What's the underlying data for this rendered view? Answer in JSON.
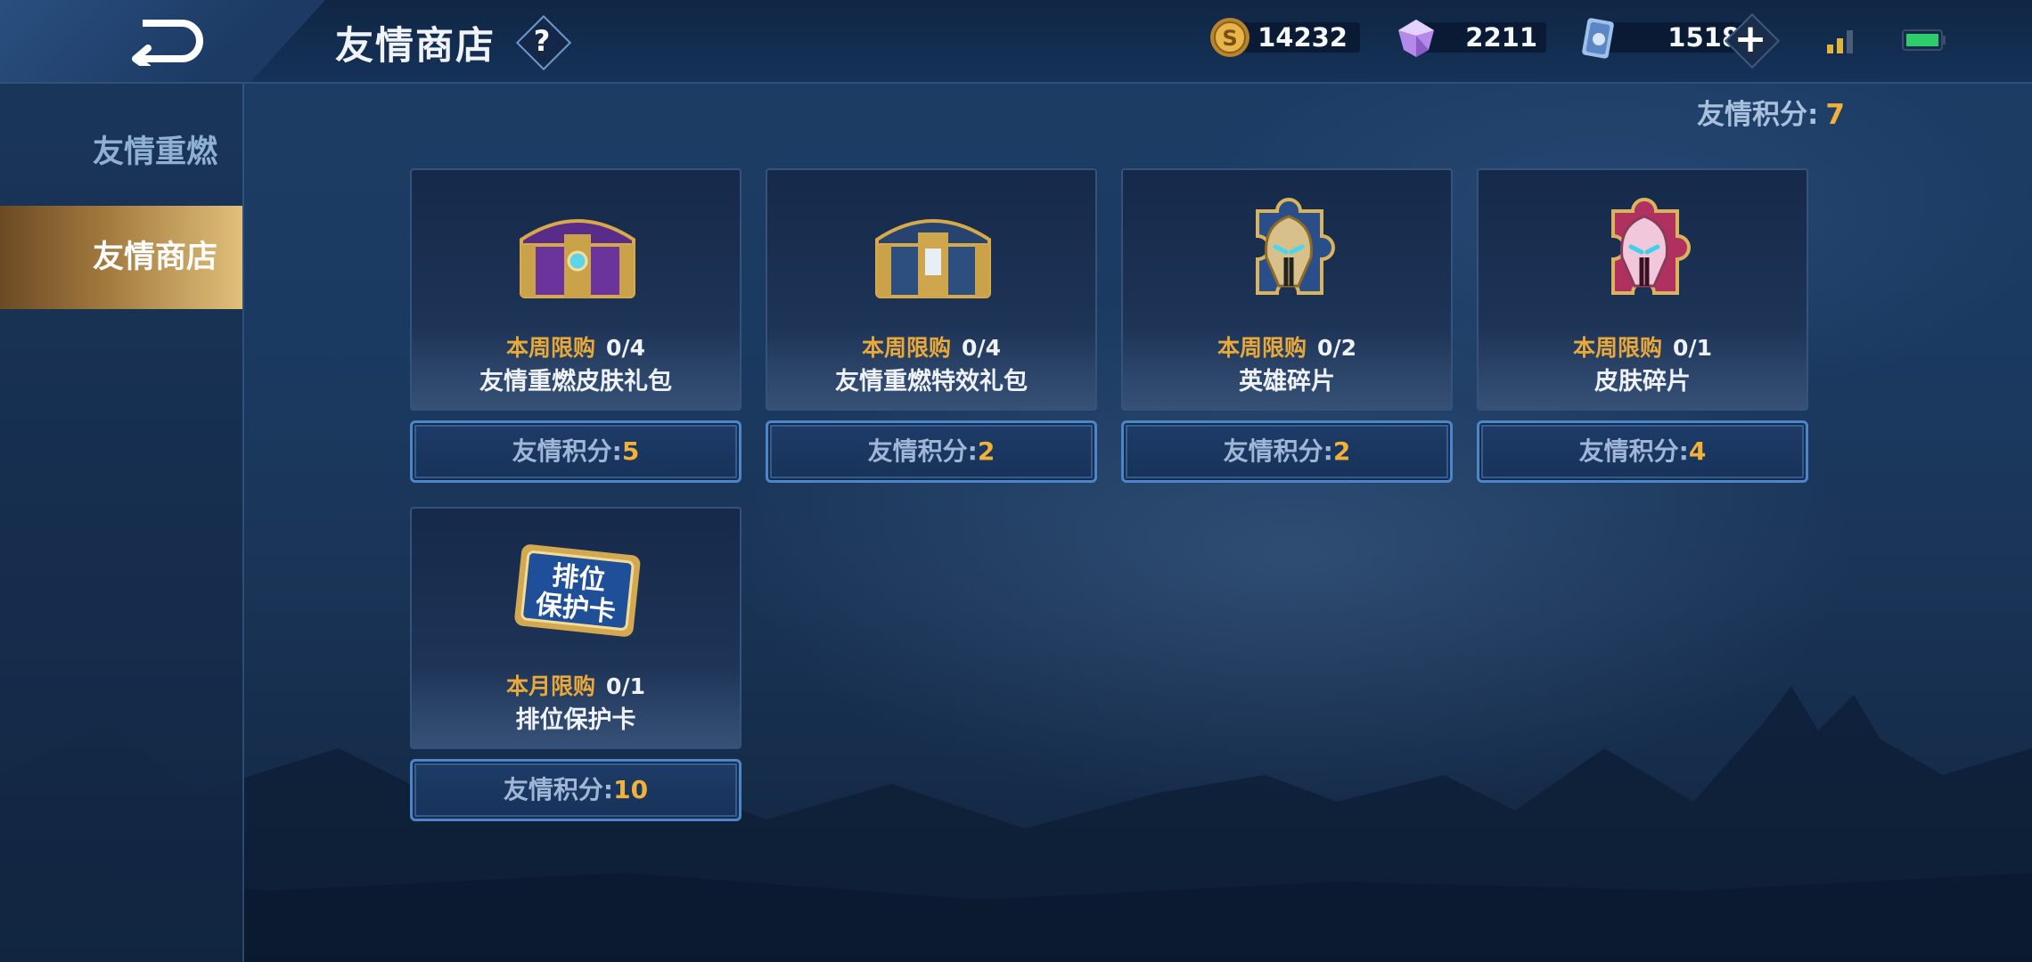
{
  "header": {
    "title": "友情商店",
    "help_label": "?",
    "currencies": [
      {
        "name": "gold-coin",
        "value": "14232"
      },
      {
        "name": "diamond",
        "value": "2211"
      },
      {
        "name": "coupon",
        "value": "1518"
      }
    ],
    "plus_label": "+"
  },
  "sidebar": {
    "items": [
      {
        "label": "友情重燃",
        "active": false
      },
      {
        "label": "友情商店",
        "active": true
      }
    ]
  },
  "score": {
    "label": "友情积分:",
    "value": "7"
  },
  "price_label": "友情积分:",
  "items": [
    {
      "limit_type": "本周限购",
      "limit_count": "0/4",
      "name": "友情重燃皮肤礼包",
      "price": "5",
      "icon": "purple-chest-icon"
    },
    {
      "limit_type": "本周限购",
      "limit_count": "0/4",
      "name": "友情重燃特效礼包",
      "price": "2",
      "icon": "blue-chest-icon"
    },
    {
      "limit_type": "本周限购",
      "limit_count": "0/2",
      "name": "英雄碎片",
      "price": "2",
      "icon": "hero-fragment-icon"
    },
    {
      "limit_type": "本周限购",
      "limit_count": "0/1",
      "name": "皮肤碎片",
      "price": "4",
      "icon": "skin-fragment-icon"
    },
    {
      "limit_type": "本月限购",
      "limit_count": "0/1",
      "name": "排位保护卡",
      "price": "10",
      "icon": "rank-protect-card-icon",
      "card_text": [
        "排位",
        "保护卡"
      ]
    }
  ],
  "colors": {
    "accent": "#f2b23a",
    "active_tab": "#a47b3f",
    "button_border": "#4d86c8"
  }
}
